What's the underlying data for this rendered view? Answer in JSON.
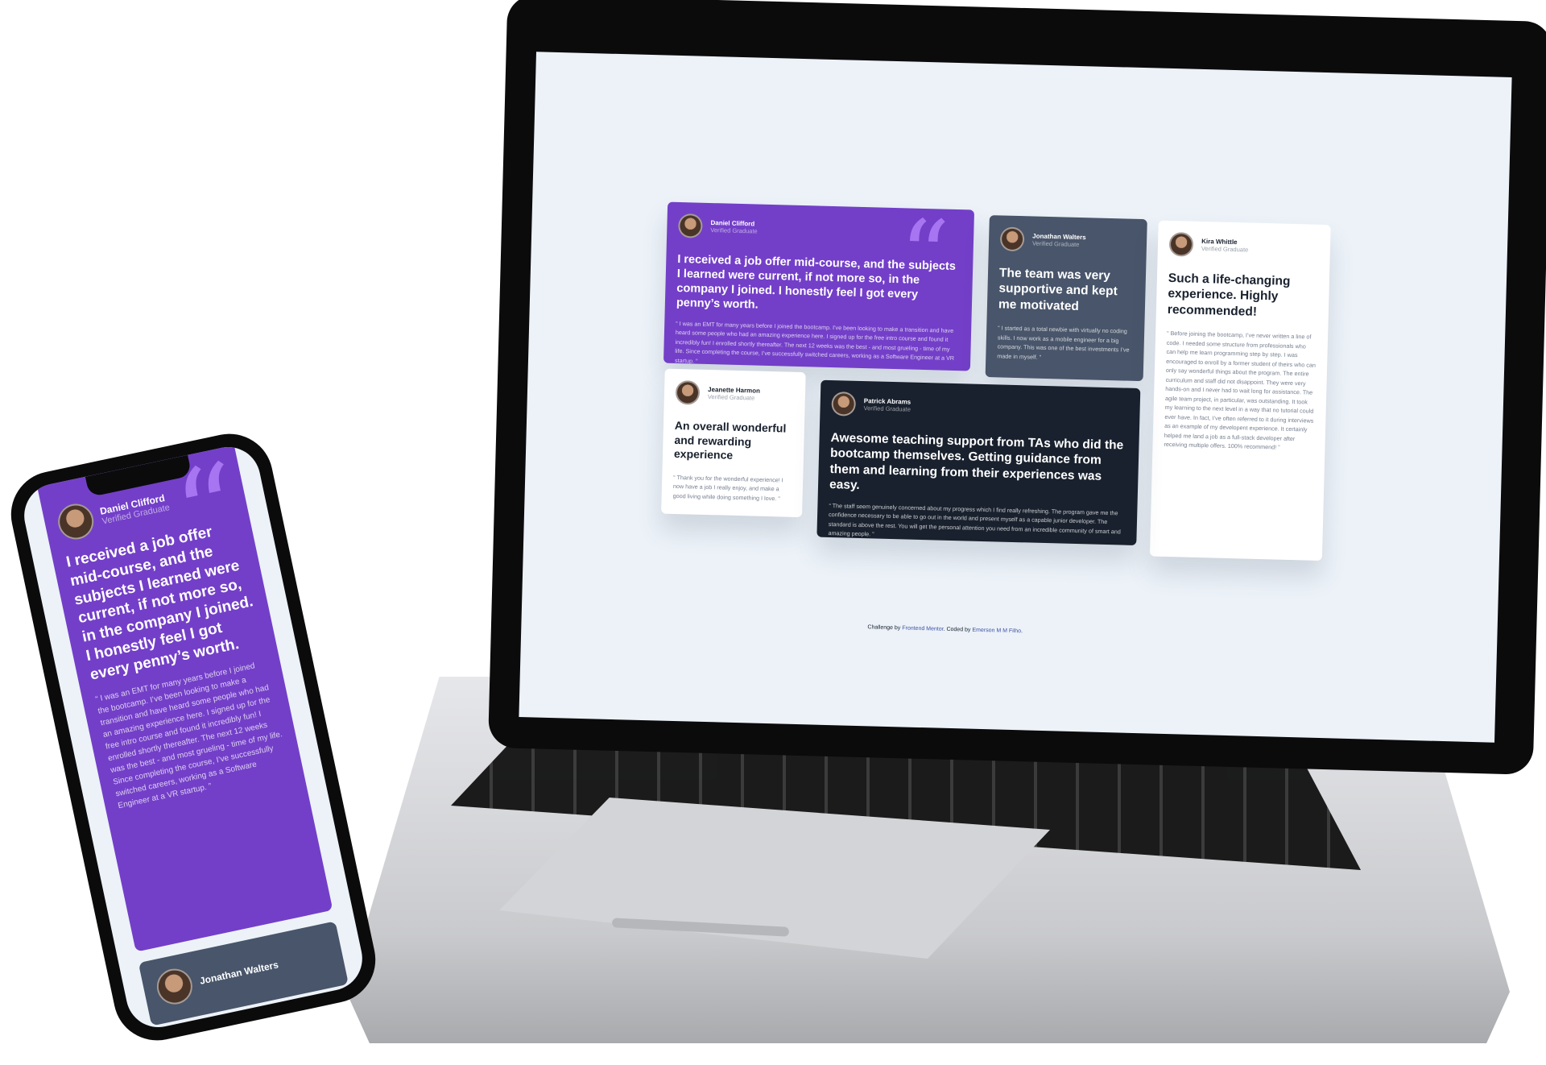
{
  "colors": {
    "purple": "#733fc8",
    "slate": "#48556a",
    "dark": "#19212e",
    "background": "#ecf2f8",
    "quote": "#a775f1"
  },
  "testimonials": [
    {
      "name": "Daniel Clifford",
      "role": "Verified Graduate",
      "title": "I received a job offer mid-course, and the subjects I learned were current, if not more so, in the company I joined. I honestly feel I got every penny’s worth.",
      "body": "“ I was an EMT for many years before I joined the bootcamp. I’ve been looking to make a transition and have heard some people who had an amazing experience here. I signed up for the free intro course and found it incredibly fun! I enrolled shortly thereafter. The next 12 weeks was the best - and most grueling - time of my life. Since completing the course, I’ve successfully switched careers, working as a Software Engineer at a VR startup. ”"
    },
    {
      "name": "Jonathan Walters",
      "role": "Verified Graduate",
      "title": "The team was very supportive and kept me motivated",
      "body": "“ I started as a total newbie with virtually no coding skills. I now work as a mobile engineer for a big company. This was one of the best investments I’ve made in myself. ”"
    },
    {
      "name": "Jeanette Harmon",
      "role": "Verified Graduate",
      "title": "An overall wonderful and rewarding experience",
      "body": "“ Thank you for the wonderful experience! I now have a job I really enjoy, and make a good living while doing something I love. ”"
    },
    {
      "name": "Patrick Abrams",
      "role": "Verified Graduate",
      "title": "Awesome teaching support from TAs who did the bootcamp themselves. Getting guidance from them and learning from their experiences was easy.",
      "body": "“ The staff seem genuinely concerned about my progress which I find really refreshing. The program gave me the confidence necessary to be able to go out in the world and present myself as a capable junior developer. The standard is above the rest. You will get the personal attention you need from an incredible community of smart and amazing people. ”"
    },
    {
      "name": "Kira Whittle",
      "role": "Verified Graduate",
      "title": "Such a life-changing experience. Highly recommended!",
      "body": "“ Before joining the bootcamp, I’ve never written a line of code. I needed some structure from professionals who can help me learn programming step by step. I was encouraged to enroll by a former student of theirs who can only say wonderful things about the program. The entire curriculum and staff did not disappoint. They were very hands-on and I never had to wait long for assistance. The agile team project, in particular, was outstanding. It took my learning to the next level in a way that no tutorial could ever have. In fact, I’ve often referred to it during interviews as an example of my developent experience. It certainly helped me land a job as a full-stack developer after receiving multiple offers. 100% recommend! ”"
    }
  ],
  "quote_mark": "“",
  "footer": {
    "prefix": "Challenge by ",
    "link1": "Frontend Mentor",
    "middle": ". Coded by ",
    "link2": "Emerson M M Filho",
    "suffix": "."
  }
}
